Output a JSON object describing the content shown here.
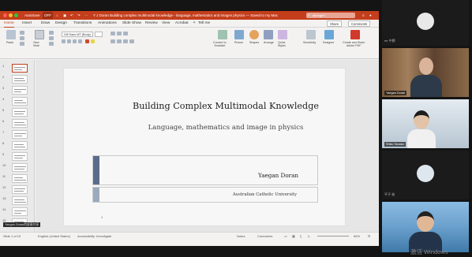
{
  "window": {
    "title": "Y J Doran Building complex multimodal knowledge - language, mathematics and images physics — Saved to my Mac",
    "autosave": "AutoSave",
    "autosave_state": "OFF",
    "search_value": "strongen"
  },
  "ribbon_tabs": [
    "Home",
    "Insert",
    "Draw",
    "Design",
    "Transitions",
    "Animations",
    "Slide Show",
    "Review",
    "View",
    "Acrobat",
    "Tell me"
  ],
  "ribbon_buttons": {
    "share": "Share",
    "comments": "Comments"
  },
  "ribbon": {
    "paste": "Paste",
    "new_slide": "New\nSlide",
    "font_name": "Gill Sans MT (Body)",
    "convert_smartart": "Convert to\nSmartArt",
    "picture": "Picture",
    "shapes": "Shapes",
    "arrange": "Arrange",
    "quick_styles": "Quick\nStyles",
    "sensitivity": "Sensitivity",
    "designer": "Designer",
    "create_share_pdf": "Create and Share\nAdobe PDF"
  },
  "thumbnails": [
    "1",
    "2",
    "3",
    "4",
    "5",
    "6",
    "7",
    "8",
    "9",
    "10",
    "11",
    "12",
    "13",
    "14",
    "15"
  ],
  "slide": {
    "title": "Building Complex Multimodal Knowledge",
    "subtitle": "Language, mathematics and image in physics",
    "author": "Yaegan Doran",
    "university": "Australian Catholic University",
    "page_number": "1"
  },
  "statusbar": {
    "slide_info": "Slide 1 of 15",
    "language": "English (United States)",
    "accessibility": "Accessibility: Investigate",
    "notes": "Notes",
    "comments": "Comments",
    "zoom": "66%"
  },
  "speaker_tag": "Yaegan Doran的屏幕共享",
  "participants": [
    {
      "label": "mr 中野",
      "type": "avatar"
    },
    {
      "label": "Yaegan Doran",
      "type": "video"
    },
    {
      "label": "Shiko Tanaka",
      "type": "video"
    },
    {
      "label": "平子 裕",
      "type": "avatar"
    },
    {
      "label": "",
      "type": "video"
    }
  ],
  "watermark": "激活 Windows",
  "colors": {
    "ppt_accent": "#c43e1c",
    "bar_dark": "#5b6b8c",
    "bar_light": "#9aabbd"
  }
}
